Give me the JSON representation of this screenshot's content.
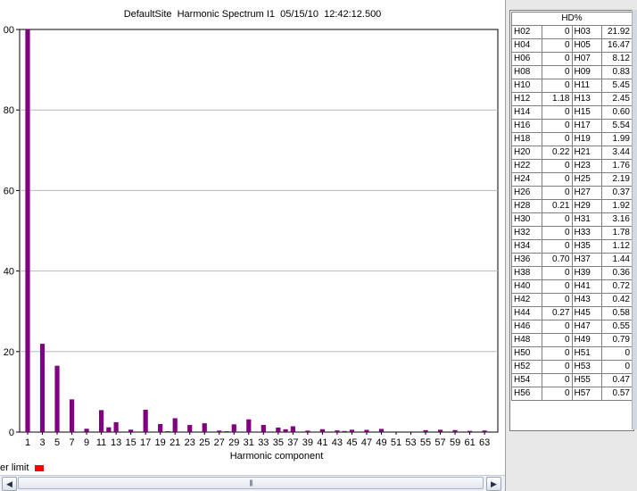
{
  "title": "DefaultSite  Harmonic Spectrum I1  05/15/10  12:42:12.500",
  "legend": {
    "label": "er limit",
    "color": "#ff0000"
  },
  "scroll_grip": "||||",
  "scroll_left": "◀",
  "scroll_right": "▶",
  "table": {
    "header": "HD%",
    "rows": [
      [
        "H02",
        "0",
        "H03",
        "21.92"
      ],
      [
        "H04",
        "0",
        "H05",
        "16.47"
      ],
      [
        "H06",
        "0",
        "H07",
        "8.12"
      ],
      [
        "H08",
        "0",
        "H09",
        "0.83"
      ],
      [
        "H10",
        "0",
        "H11",
        "5.45"
      ],
      [
        "H12",
        "1.18",
        "H13",
        "2.45"
      ],
      [
        "H14",
        "0",
        "H15",
        "0.60"
      ],
      [
        "H16",
        "0",
        "H17",
        "5.54"
      ],
      [
        "H18",
        "0",
        "H19",
        "1.99"
      ],
      [
        "H20",
        "0.22",
        "H21",
        "3.44"
      ],
      [
        "H22",
        "0",
        "H23",
        "1.76"
      ],
      [
        "H24",
        "0",
        "H25",
        "2.19"
      ],
      [
        "H26",
        "0",
        "H27",
        "0.37"
      ],
      [
        "H28",
        "0.21",
        "H29",
        "1.92"
      ],
      [
        "H30",
        "0",
        "H31",
        "3.16"
      ],
      [
        "H32",
        "0",
        "H33",
        "1.78"
      ],
      [
        "H34",
        "0",
        "H35",
        "1.12"
      ],
      [
        "H36",
        "0.70",
        "H37",
        "1.44"
      ],
      [
        "H38",
        "0",
        "H39",
        "0.36"
      ],
      [
        "H40",
        "0",
        "H41",
        "0.72"
      ],
      [
        "H42",
        "0",
        "H43",
        "0.42"
      ],
      [
        "H44",
        "0.27",
        "H45",
        "0.58"
      ],
      [
        "H46",
        "0",
        "H47",
        "0.55"
      ],
      [
        "H48",
        "0",
        "H49",
        "0.79"
      ],
      [
        "H50",
        "0",
        "H51",
        "0"
      ],
      [
        "H52",
        "0",
        "H53",
        "0"
      ],
      [
        "H54",
        "0",
        "H55",
        "0.47"
      ],
      [
        "H56",
        "0",
        "H57",
        "0.57"
      ]
    ]
  },
  "chart_data": {
    "type": "bar",
    "title": "DefaultSite  Harmonic Spectrum I1  05/15/10  12:42:12.500",
    "xlabel": "Harmonic component",
    "ylabel": "",
    "ylim": [
      0,
      100
    ],
    "y_tick_labels_visible": [
      "00",
      "80",
      "60",
      "40",
      "20",
      "0"
    ],
    "y_ticks": [
      100,
      80,
      60,
      40,
      20,
      0
    ],
    "x_tick_labels": [
      "1",
      "3",
      "5",
      "7",
      "9",
      "11",
      "13",
      "15",
      "17",
      "19",
      "21",
      "23",
      "25",
      "27",
      "29",
      "31",
      "33",
      "35",
      "37",
      "39",
      "41",
      "43",
      "45",
      "47",
      "49",
      "51",
      "53",
      "55",
      "57",
      "59",
      "61",
      "63"
    ],
    "grid": true,
    "bar_color": "#800080",
    "categories": [
      "1",
      "2",
      "3",
      "4",
      "5",
      "6",
      "7",
      "8",
      "9",
      "10",
      "11",
      "12",
      "13",
      "14",
      "15",
      "16",
      "17",
      "18",
      "19",
      "20",
      "21",
      "22",
      "23",
      "24",
      "25",
      "26",
      "27",
      "28",
      "29",
      "30",
      "31",
      "32",
      "33",
      "34",
      "35",
      "36",
      "37",
      "38",
      "39",
      "40",
      "41",
      "42",
      "43",
      "44",
      "45",
      "46",
      "47",
      "48",
      "49",
      "50",
      "51",
      "52",
      "53",
      "54",
      "55",
      "56",
      "57",
      "58",
      "59",
      "60",
      "61",
      "62",
      "63"
    ],
    "values": [
      100,
      0,
      21.92,
      0,
      16.47,
      0,
      8.12,
      0,
      0.83,
      0,
      5.45,
      1.18,
      2.45,
      0,
      0.6,
      0,
      5.54,
      0,
      1.99,
      0.22,
      3.44,
      0,
      1.76,
      0,
      2.19,
      0,
      0.37,
      0.21,
      1.92,
      0,
      3.16,
      0,
      1.78,
      0,
      1.12,
      0.7,
      1.44,
      0,
      0.36,
      0,
      0.72,
      0,
      0.42,
      0.27,
      0.58,
      0,
      0.55,
      0,
      0.79,
      0,
      0,
      0,
      0,
      0,
      0.47,
      0,
      0.57,
      0,
      0.5,
      0,
      0.3,
      0,
      0.4
    ]
  }
}
